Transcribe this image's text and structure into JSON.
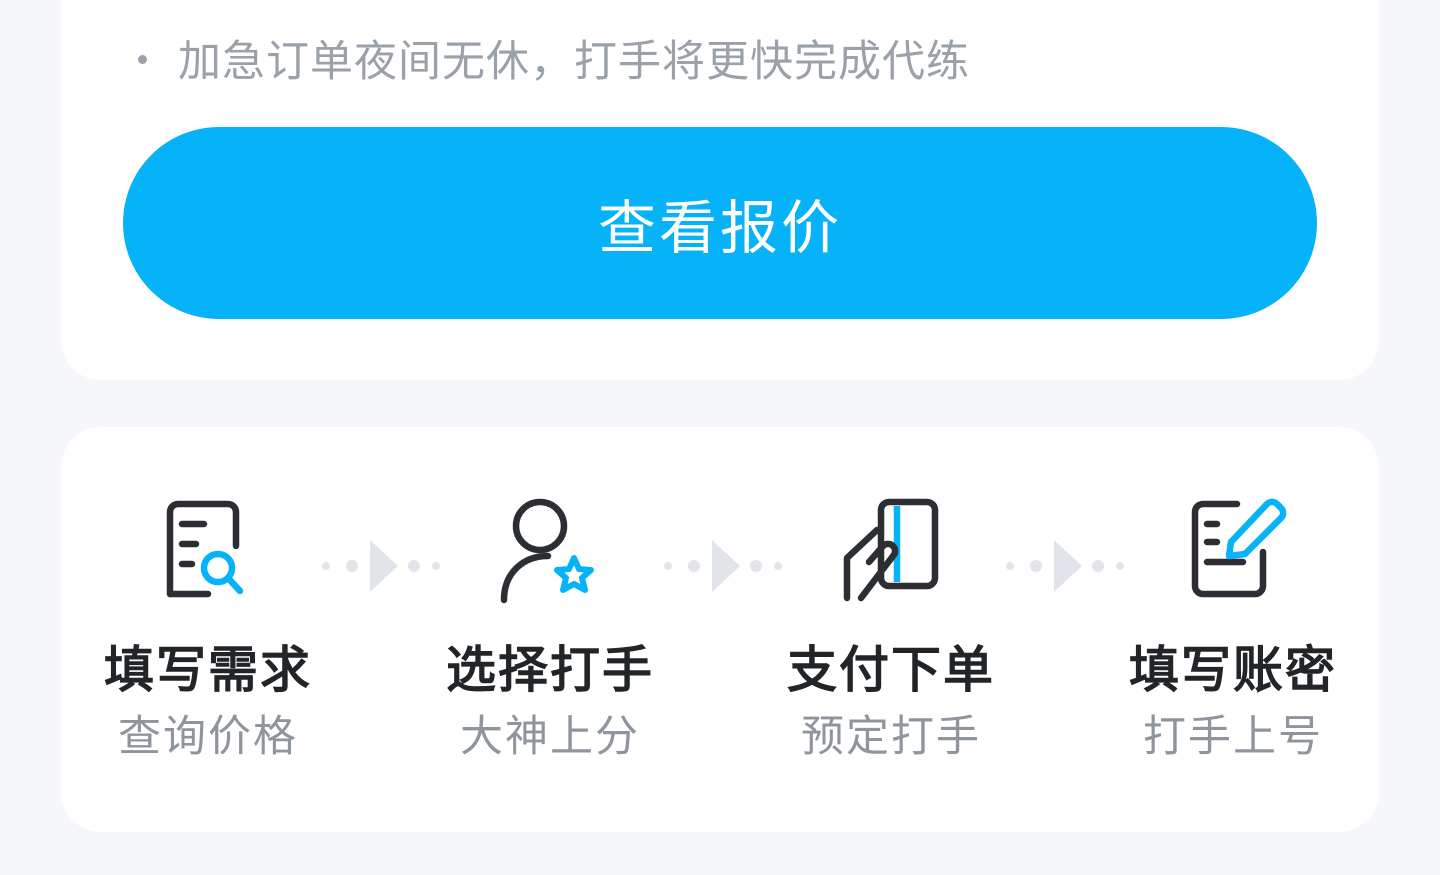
{
  "note": {
    "text": "加急订单夜间无休，打手将更快完成代练"
  },
  "primary_action": {
    "label": "查看报价",
    "color": "#06b3f8"
  },
  "steps": [
    {
      "icon": "document-search-icon",
      "title": "填写需求",
      "subtitle": "查询价格"
    },
    {
      "icon": "user-star-icon",
      "title": "选择打手",
      "subtitle": "大神上分"
    },
    {
      "icon": "hand-card-icon",
      "title": "支付下单",
      "subtitle": "预定打手"
    },
    {
      "icon": "document-edit-icon",
      "title": "填写账密",
      "subtitle": "打手上号"
    }
  ],
  "colors": {
    "accent": "#06b3f8",
    "icon_stroke": "#2b2f33",
    "connector": "#e1e4e8",
    "background": "#f5f7fa"
  }
}
